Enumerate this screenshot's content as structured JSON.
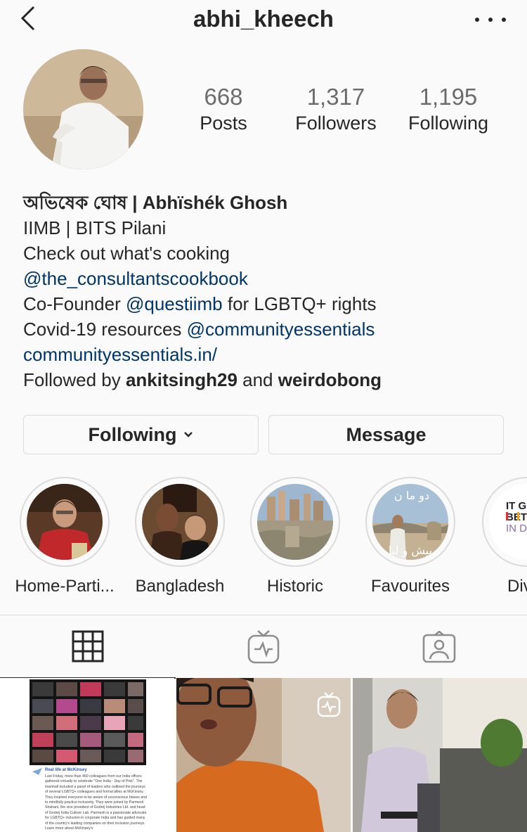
{
  "header": {
    "username": "abhi_kheech",
    "back_icon": "chevron-left-icon",
    "more_icon": "more-horizontal-icon"
  },
  "stats": {
    "posts": {
      "value": "668",
      "label": "Posts"
    },
    "followers": {
      "value": "1,317",
      "label": "Followers"
    },
    "following": {
      "value": "1,195",
      "label": "Following"
    }
  },
  "bio": {
    "name": "অভিষেক ঘোষ | Abhïshék Ghosh",
    "line1": "IIMB | BITS Pilani",
    "line2": "Check out what's cooking",
    "line3_link": "@the_consultantscookbook",
    "line4_prefix": "Co-Founder ",
    "line4_link": "@questiimb",
    "line4_suffix": " for LGBTQ+ rights",
    "line5_prefix": "Covid-19 resources ",
    "line5_link": "@communityessentials",
    "website": "communityessentials.in/",
    "followed_prefix": "Followed by ",
    "followed_user1": "ankitsingh29",
    "followed_and": " and ",
    "followed_user2": "weirdobong"
  },
  "actions": {
    "following_label": "Following",
    "message_label": "Message"
  },
  "highlights": [
    {
      "label": "Home-Parti..."
    },
    {
      "label": "Bangladesh"
    },
    {
      "label": "Historic"
    },
    {
      "label": "Favourites"
    },
    {
      "label": "Diver"
    }
  ],
  "highlight_thumb_text": {
    "favourites_top": "دو ما ن",
    "favourites_bottom": "بیش و لیا",
    "diversity_lines": [
      "IT G",
      "BETT",
      "IN D"
    ]
  },
  "tabs": [
    {
      "icon": "grid-icon",
      "active": true
    },
    {
      "icon": "igtv-icon",
      "active": false
    },
    {
      "icon": "tagged-icon",
      "active": false
    }
  ],
  "posts": [
    {
      "type": "image",
      "caption_title": "Real life at McKinsey",
      "caption_body": "Last Friday, more than 460 colleagues from our India offices gathered virtually to celebrate \"One India - Day of Pink\". The townhall included a panel of leaders who outlined the journeys of several LGBTQ+ colleagues and formal allies at McKinsey. They inspired everyone to be aware of unconscious biases and to mindfully practice inclusivity. They were joined by Parmesh Shahani, the vice president of Godrej Industries Ltd. and head of Godrej India Culture Lab. Parmesh is a passionate advocate for LGBTQ+ inclusion in corporate India and has guided many of the country's leading companies on their inclusion journeys. Learn more about McKinsey's"
    },
    {
      "type": "igtv"
    },
    {
      "type": "image"
    }
  ]
}
